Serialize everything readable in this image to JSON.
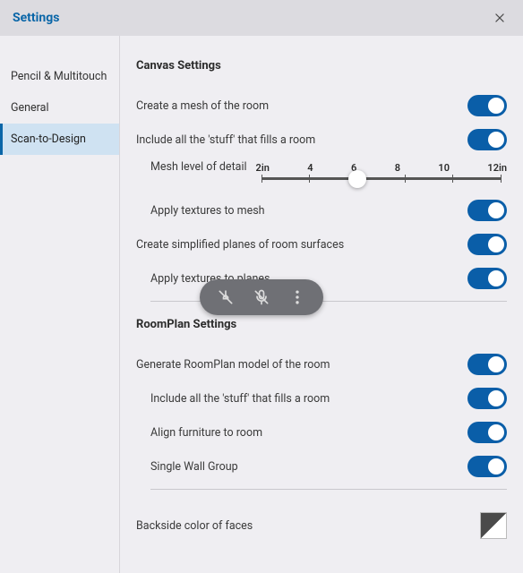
{
  "title": "Settings",
  "sidebar": {
    "items": [
      {
        "label": "Pencil & Multitouch"
      },
      {
        "label": "General"
      },
      {
        "label": "Scan-to-Design"
      }
    ],
    "selectedIndex": 2
  },
  "sections": {
    "canvas": {
      "title": "Canvas Settings",
      "createMesh": "Create a mesh of the room",
      "includeStuff": "Include all the 'stuff' that fills a room",
      "meshDetail": "Mesh level of detail",
      "meshDetailTicks": [
        "2in",
        "4",
        "6",
        "8",
        "10",
        "12in"
      ],
      "meshDetailValueIndex": 2,
      "applyTexturesMesh": "Apply textures to mesh",
      "createPlanes": "Create simplified planes of room surfaces",
      "applyTexturesPlanes": "Apply textures to planes"
    },
    "roomplan": {
      "title": "RoomPlan Settings",
      "generateModel": "Generate RoomPlan model of the room",
      "includeStuff": "Include all the 'stuff' that fills a room",
      "alignFurniture": "Align furniture to room",
      "singleWallGroup": "Single Wall Group"
    },
    "backside": {
      "label": "Backside color of faces"
    }
  },
  "icons": {
    "pin": "pin-off-icon",
    "mic": "mic-off-icon",
    "more": "more-vertical-icon"
  },
  "colors": {
    "accent": "#0a5ea8",
    "titlebar": "#dcdbe0",
    "background": "#efeef2",
    "selectedTab": "#cfe2f2"
  }
}
